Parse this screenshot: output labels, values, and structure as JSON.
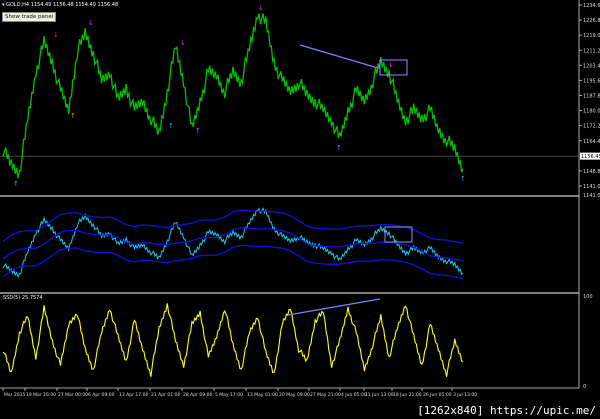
{
  "header": {
    "symbol": "GOLD,H4",
    "values": "1154.49 1156.48 1154.49 1156.48"
  },
  "trade_panel_button": "Show trade panel",
  "price_axis": [
    "1234.60",
    "1226.80",
    "1219.00",
    "1211.20",
    "1203.40",
    "1195.60",
    "1187.80",
    "1180.00",
    "1172.20",
    "1164.40",
    "1148.80",
    "1141.00"
  ],
  "current_price": "1156.45",
  "sub1_axis": "1141.00",
  "sub2": {
    "label": "SSD(5) 25.7574",
    "max": "100",
    "min": "0"
  },
  "time_axis": [
    "Mar 2015",
    "19 Mar 16:00",
    "27 Mar 00:00",
    "6 Apr 09:00",
    "13 Apr 17:00",
    "21 Apr 01:00",
    "28 Apr 09:00",
    "5 May 17:00",
    "13 May 01:00",
    "20 May 09:00",
    "27 May 21:00",
    "4 Jun 05:00",
    "11 Jun 13:00",
    "18 Jun 21:00",
    "26 Jun 05:00",
    "3 Jul 13:00"
  ],
  "watermark": "[1262x840] https://upic.me/",
  "colors": {
    "price": "#00c000",
    "line": "#1ec8f0",
    "bands": "#1010e0",
    "osc": "#ffff20",
    "annot": "#8080ff",
    "up": "#20b0ff",
    "down": "#ff20ff",
    "red": "#ff2020",
    "orange": "#ff9020"
  },
  "chart_data": {
    "type": "line",
    "price_range": [
      1141,
      1234.6
    ],
    "price": [
      1160,
      1152,
      1148,
      1175,
      1200,
      1215,
      1205,
      1190,
      1180,
      1210,
      1220,
      1210,
      1195,
      1200,
      1185,
      1192,
      1180,
      1185,
      1176,
      1168,
      1190,
      1213,
      1195,
      1170,
      1185,
      1200,
      1198,
      1190,
      1200,
      1195,
      1212,
      1230,
      1225,
      1205,
      1195,
      1190,
      1195,
      1188,
      1185,
      1180,
      1175,
      1165,
      1180,
      1190,
      1185,
      1195,
      1205,
      1200,
      1185,
      1175,
      1180,
      1176,
      1180,
      1170,
      1165,
      1160,
      1150
    ],
    "osc": [
      40,
      10,
      60,
      80,
      30,
      90,
      50,
      20,
      70,
      85,
      40,
      15,
      60,
      90,
      55,
      25,
      75,
      40,
      10,
      65,
      95,
      50,
      20,
      70,
      85,
      30,
      55,
      90,
      45,
      15,
      60,
      80,
      35,
      10,
      70,
      90,
      40,
      25,
      75,
      85,
      20,
      50,
      90,
      60,
      15,
      45,
      80,
      30,
      65,
      95,
      55,
      20,
      70,
      40,
      10,
      50,
      25
    ]
  }
}
